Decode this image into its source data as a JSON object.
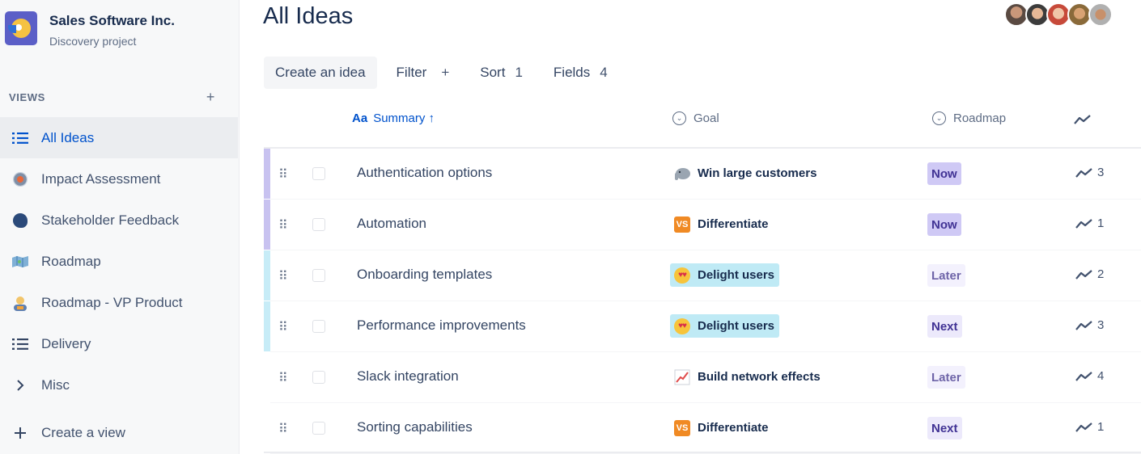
{
  "project": {
    "name": "Sales Software Inc.",
    "subtitle": "Discovery project"
  },
  "views": {
    "header": "VIEWS",
    "add_label": "+",
    "items": [
      {
        "label": "All Ideas",
        "icon": "list-icon",
        "active": true
      },
      {
        "label": "Impact Assessment",
        "icon": "target-icon"
      },
      {
        "label": "Stakeholder Feedback",
        "icon": "speaking-head-icon"
      },
      {
        "label": "Roadmap",
        "icon": "map-icon"
      },
      {
        "label": "Roadmap - VP Product",
        "icon": "person-icon"
      },
      {
        "label": "Delivery",
        "icon": "list-icon"
      },
      {
        "label": "Misc",
        "icon": "chevron-right-icon"
      }
    ],
    "create_label": "Create a view"
  },
  "page": {
    "title": "All Ideas"
  },
  "toolbar": {
    "create_label": "Create an idea",
    "filter_label": "Filter",
    "filter_plus": "+",
    "sort_label": "Sort",
    "sort_count": "1",
    "fields_label": "Fields",
    "fields_count": "4"
  },
  "columns": {
    "summary_prefix": "Aa",
    "summary": "Summary ↑",
    "goal": "Goal",
    "roadmap": "Roadmap"
  },
  "rows": [
    {
      "summary": "Authentication options",
      "goal": "Win large customers",
      "goal_icon": "elephant-icon",
      "roadmap": "Now",
      "impact": "3",
      "strip": "#c8c2f0"
    },
    {
      "summary": "Automation",
      "goal": "Differentiate",
      "goal_icon": "vs-icon",
      "roadmap": "Now",
      "impact": "1",
      "strip": "#c8c2f0"
    },
    {
      "summary": "Onboarding templates",
      "goal": "Delight users",
      "goal_icon": "heart-eyes-icon",
      "roadmap": "Later",
      "impact": "2",
      "strip": "#c7ecf7"
    },
    {
      "summary": "Performance improvements",
      "goal": "Delight users",
      "goal_icon": "heart-eyes-icon",
      "roadmap": "Next",
      "impact": "3",
      "strip": "#c7ecf7"
    },
    {
      "summary": "Slack integration",
      "goal": "Build network effects",
      "goal_icon": "chart-increasing-icon",
      "roadmap": "Later",
      "impact": "4",
      "strip": ""
    },
    {
      "summary": "Sorting capabilities",
      "goal": "Differentiate",
      "goal_icon": "vs-icon",
      "roadmap": "Next",
      "impact": "1",
      "strip": ""
    }
  ],
  "colors": {
    "now_bg": "#cfc9f5",
    "now_fg": "#403294",
    "later_bg": "#f3f1fd",
    "later_fg": "#6e64a8",
    "next_bg": "#ece9fb",
    "next_fg": "#403294",
    "goal_highlight": "#bfeaf5",
    "accent": "#0052cc"
  }
}
